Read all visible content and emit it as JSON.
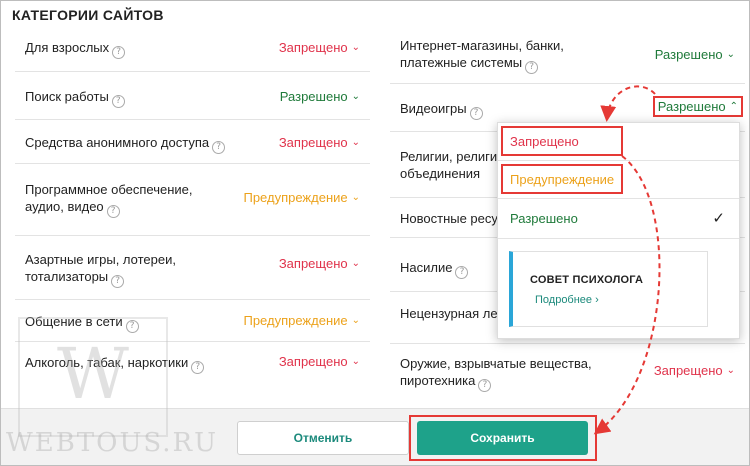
{
  "title": "КАТЕГОРИИ САЙТОВ",
  "left_rows": [
    {
      "label": "Для взрослых",
      "status": "Запрещено",
      "kind": "forbid"
    },
    {
      "label": "Поиск работы",
      "status": "Разрешено",
      "kind": "allow"
    },
    {
      "label": "Средства анонимного доступа",
      "status": "Запрещено",
      "kind": "forbid"
    },
    {
      "label1": "Программное обеспечение,",
      "label2": "аудио, видео",
      "status": "Предупреждение",
      "kind": "warn"
    },
    {
      "label1": "Азартные игры, лотереи,",
      "label2": "тотализаторы",
      "status": "Запрещено",
      "kind": "forbid"
    },
    {
      "label": "Общение в сети",
      "status": "Предупреждение",
      "kind": "warn"
    },
    {
      "label": "Алкоголь, табак, наркотики",
      "status": "Запрещено",
      "kind": "forbid"
    }
  ],
  "right_rows": [
    {
      "label1": "Интернет-магазины, банки,",
      "label2": "платежные системы",
      "status": "Разрешено",
      "kind": "allow"
    },
    {
      "label": "Видеоигры",
      "status": "Разрешено",
      "kind": "allow",
      "open": true
    },
    {
      "label1": "Религии, религи",
      "label2": "объединения"
    },
    {
      "label": "Новостные ресу"
    },
    {
      "label": "Насилие"
    },
    {
      "label": "Нецензурная ле"
    },
    {
      "label1": "Оружие, взрывчатые вещества,",
      "label2": "пиротехника",
      "status": "Запрещено",
      "kind": "forbid"
    }
  ],
  "dropdown": {
    "options": [
      "Запрещено",
      "Предупреждение",
      "Разрешено"
    ],
    "selected": "Разрешено",
    "tip_title": "СОВЕТ ПСИХОЛОГА",
    "tip_link": "Подробнее",
    "tip_link_chevron": "›"
  },
  "buttons": {
    "cancel": "Отменить",
    "save": "Сохранить"
  },
  "watermark": {
    "letter": "W",
    "text": "WEBTOUS.RU"
  },
  "glyphs": {
    "help": "?",
    "chevron_down": "⌄",
    "chevron_up": "⌃",
    "check": "✓"
  },
  "colors": {
    "forbid": "#e0334b",
    "warn": "#eca21b",
    "allow": "#1f7a3a",
    "accent": "#1ea28a",
    "highlight": "#e53935"
  }
}
